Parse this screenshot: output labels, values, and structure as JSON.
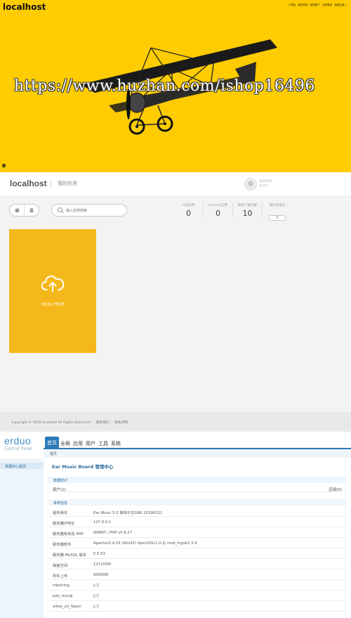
{
  "hero": {
    "brand": "localhost",
    "topnav": [
      "{ 网站",
      "我的网站",
      "我的账户",
      "立即登录",
      "免费注册 }"
    ],
    "watermark": "https://www.huzhan.com/ishop16496",
    "corner_mark": "B",
    "bg_color": "#fecc00"
  },
  "app": {
    "title": "localhost",
    "subtitle": "我的应用",
    "search_placeholder": "输入名称搜索",
    "os_icons": [
      "apple-icon",
      "android-icon"
    ],
    "stats": [
      {
        "label": "iOS应用",
        "value": "0"
      },
      {
        "label": "Android应用",
        "value": "0"
      },
      {
        "label": "剩余下载次数",
        "value": "10"
      },
      {
        "label": "我的充值包",
        "button": "充"
      }
    ],
    "upload_label": "点此处上传应用",
    "card_color": "#f5b81a",
    "footer": [
      "Copyright © 2019 localhost  All Rights Reserved.",
      "联系我们",
      "隐私声明"
    ]
  },
  "admin": {
    "logo_main": "erduo",
    "logo_sub": "Control Panel",
    "nav": [
      "首页",
      "全局",
      "应用",
      "用户",
      "工具",
      "系统"
    ],
    "breadcrumb": "首页",
    "sidebar_item": "管理中心首页",
    "page_title": "Ear Music Board 管理中心",
    "section_stats": "数据统计",
    "stats_left": "用户(1)",
    "stats_right": "应用(0)",
    "section_sys": "系统信息",
    "rows": [
      {
        "k": "程序版本",
        "v": "Ear Music 5.0 简体中文GBK 20190311"
      },
      {
        "k": "服务器IP地址",
        "v": "127.0.0.1"
      },
      {
        "k": "服务器系统及 PHP",
        "v": "WINNT / PHP v5.6.27"
      },
      {
        "k": "服务器软件",
        "v": "Apache/2.4.23 (Win32) OpenSSL/1.0.2j mod_fcgid/2.3.9"
      },
      {
        "k": "服务器 MySQL 版本",
        "v": "5.5.53"
      },
      {
        "k": "磁盘空间",
        "v": "121155M"
      },
      {
        "k": "附件上传",
        "v": "80000M"
      },
      {
        "k": "mbstring",
        "v": "[√]"
      },
      {
        "k": "pdo_mysql",
        "v": "[√]"
      },
      {
        "k": "allow_url_fopen",
        "v": "[√]"
      }
    ]
  }
}
